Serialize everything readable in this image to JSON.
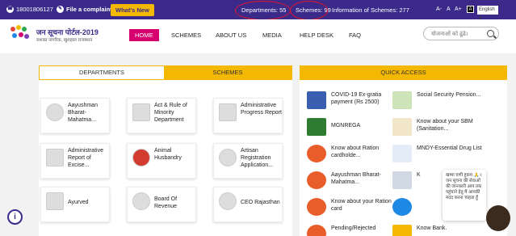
{
  "topbar": {
    "helpline": "18001806127",
    "complaint": "File a complaint",
    "whats_new": "What's New",
    "departments": "Departments: 55",
    "schemes": "Schemes: 99",
    "info_schemes": "Information of Schemes: 277",
    "font_minus": "A-",
    "font_normal": "A",
    "font_plus": "A+",
    "contrast": "A",
    "language": "English"
  },
  "brand": {
    "title": "जन सूचना पोर्टल-2019",
    "tagline": "सशक्त नागरिक, खुशहाल राजस्थान"
  },
  "nav": {
    "items": [
      "HOME",
      "SCHEMES",
      "ABOUT US",
      "MEDIA",
      "HELP DESK",
      "FAQ"
    ],
    "search_placeholder": "योजनाओं को ढूंढे।"
  },
  "tabs": {
    "departments": "DEPARTMENTS",
    "schemes": "SCHEMES"
  },
  "departments": [
    {
      "title": "Aayushman Bharat-Mahatma..."
    },
    {
      "title": "Act & Rule of Minority Department"
    },
    {
      "title": "Administrative Progress Report"
    },
    {
      "title": "Administrative Report of Excise..."
    },
    {
      "title": "Animal Husbandry"
    },
    {
      "title": "Artisan Registration Application..."
    },
    {
      "title": "Ayurved"
    },
    {
      "title": "Board Of Revenue"
    },
    {
      "title": "CEO Rajasthan"
    }
  ],
  "quick_access": {
    "title": "QUICK ACCESS",
    "items": [
      {
        "title": "COVID-19 Ex-gratia payment (Rs 2500)"
      },
      {
        "title": "Social Security Pension..."
      },
      {
        "title": "MGNREGA"
      },
      {
        "title": "Know about your SBM (Sanitation..."
      },
      {
        "title": "Know about Ration cardholde..."
      },
      {
        "title": "MNDY-Essential Drug List"
      },
      {
        "title": "Aayushman Bharat-Mahatma..."
      },
      {
        "title": "K"
      },
      {
        "title": "Know about your Ration card"
      },
      {
        "title": ""
      },
      {
        "title": "Pending/Rejected"
      },
      {
        "title": "Know Bank."
      }
    ]
  },
  "popup": {
    "text": "खम्मा घणी हुकम 🙏 जन सूचना की सेवाओं की जानकारी आप तक पहुंचाने हेतु मैं आपकी मदद करना चाहता हूँ",
    "close": "x"
  },
  "info_button": "i"
}
